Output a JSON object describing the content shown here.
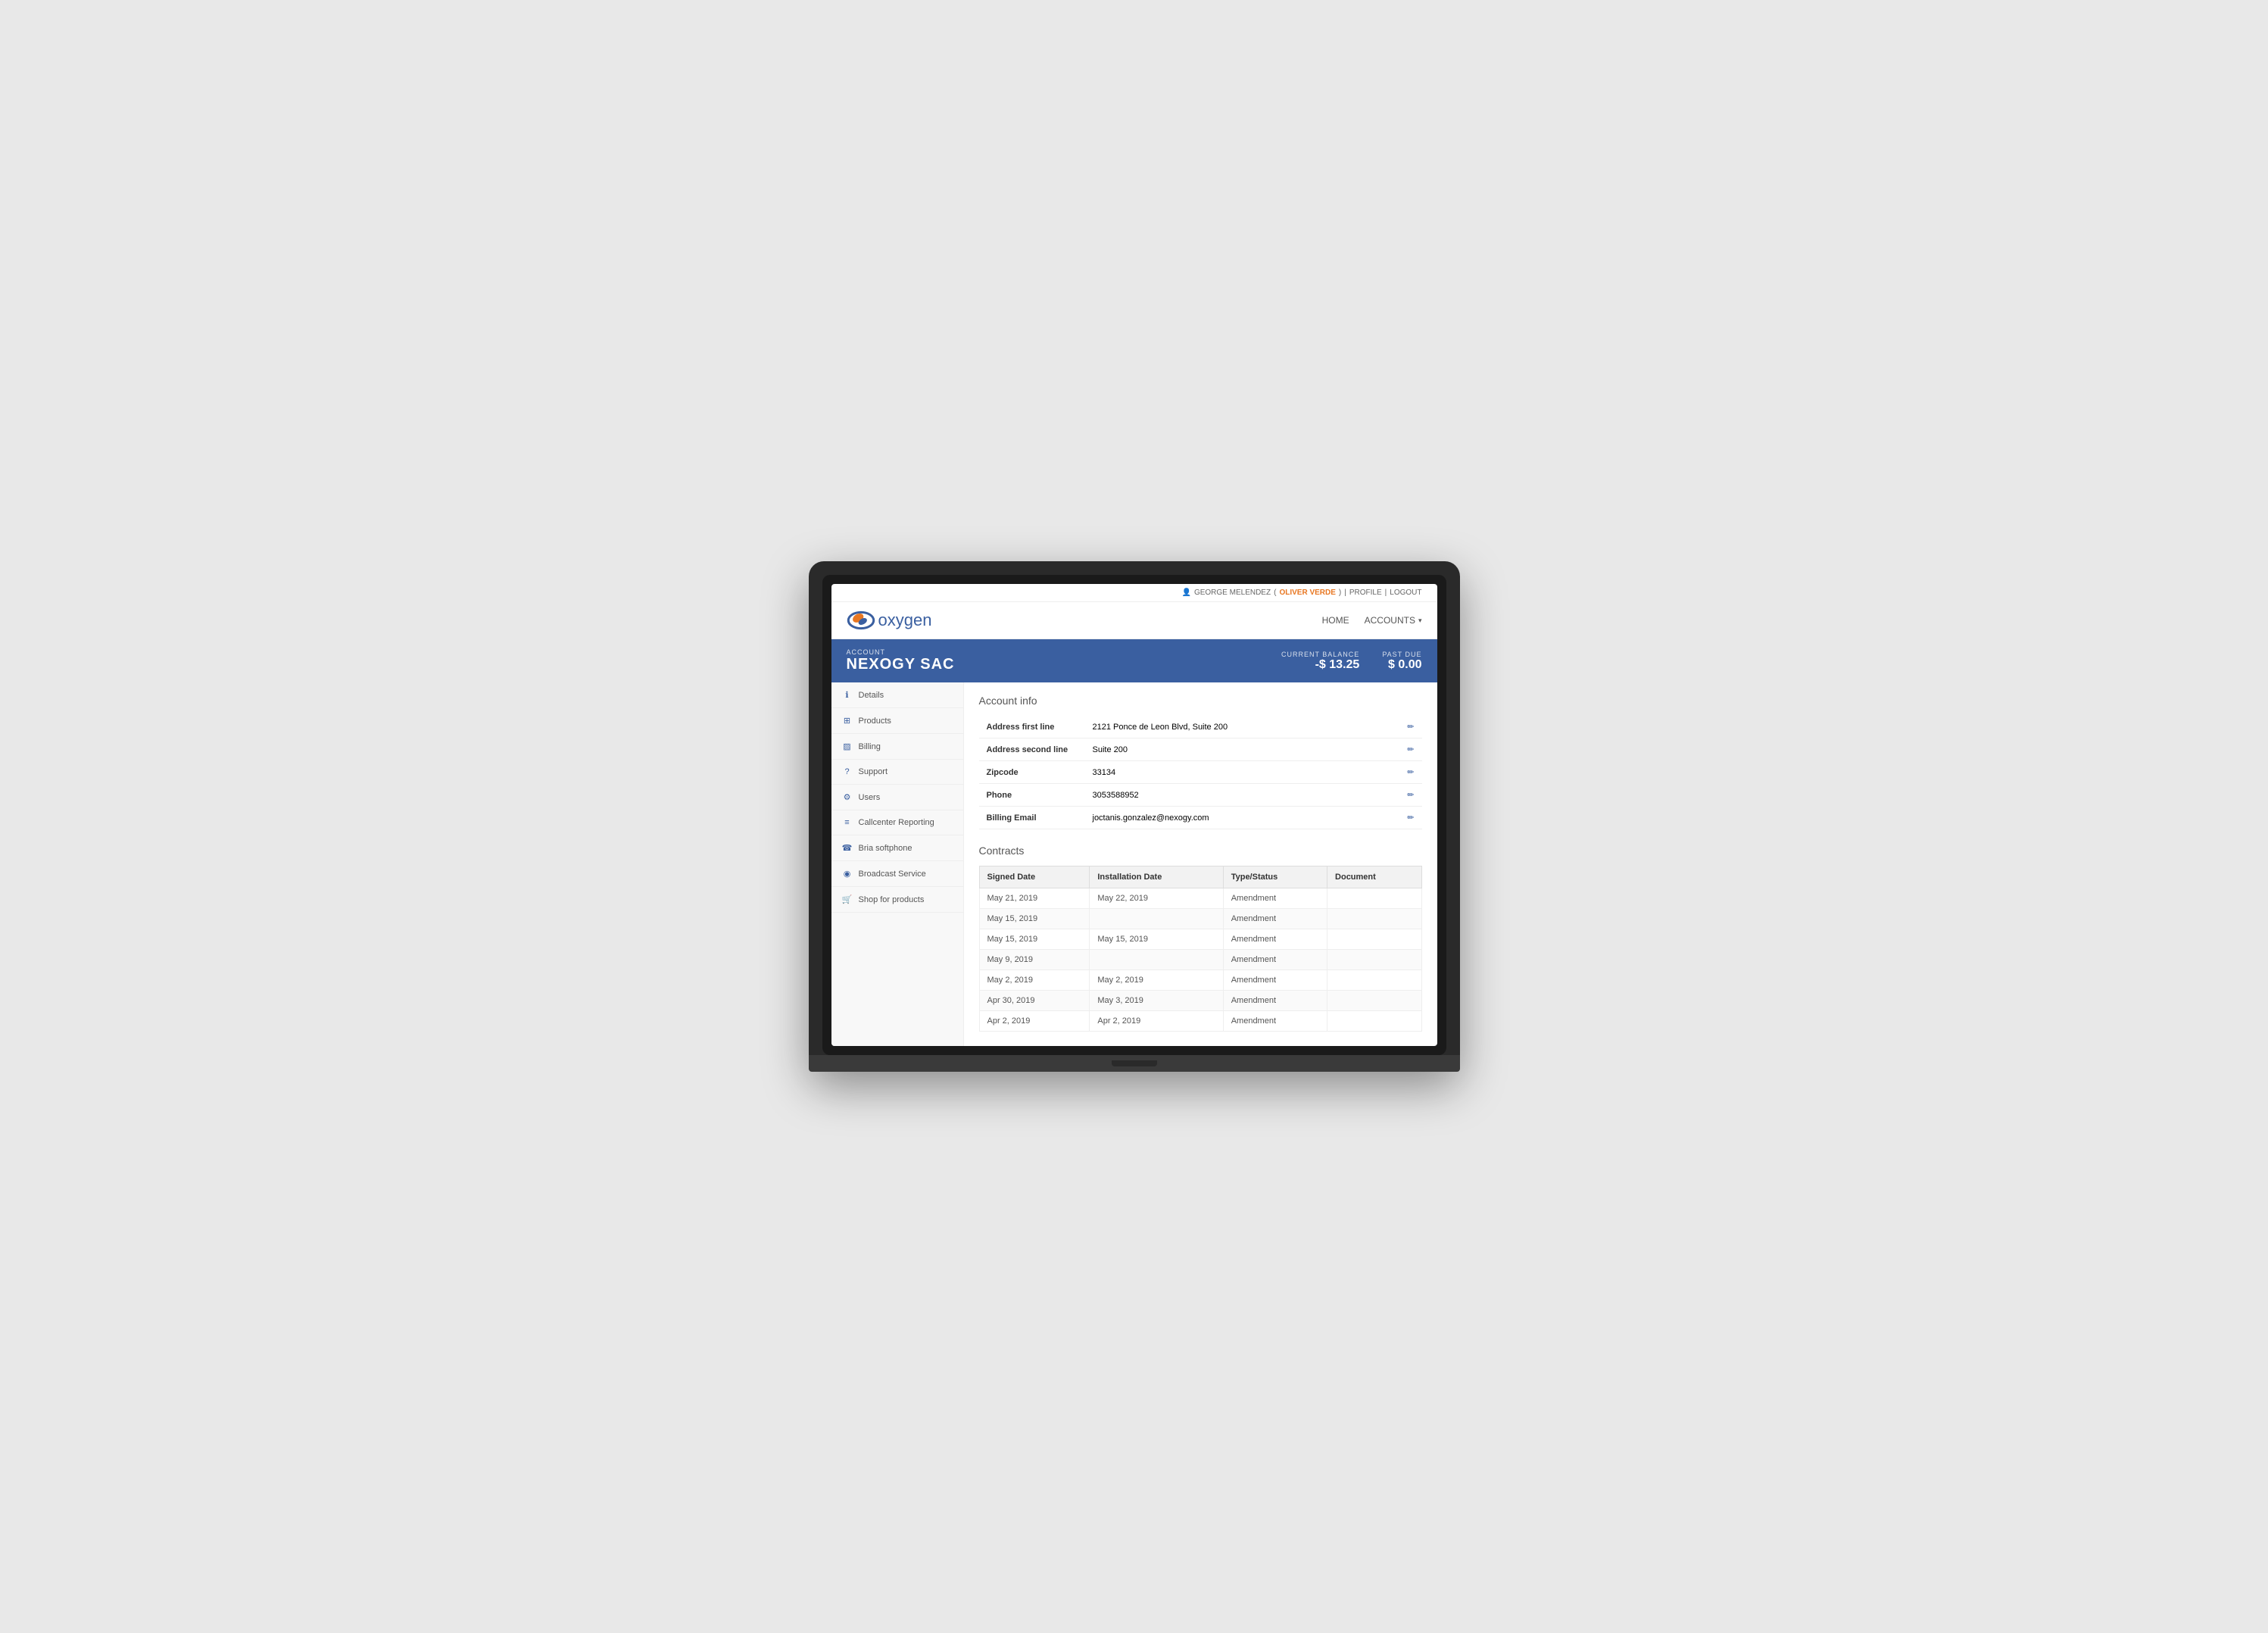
{
  "topbar": {
    "user_label": "GEORGE MELENDEZ",
    "company": "OLIVER VERDE",
    "profile_label": "PROFILE",
    "logout_label": "LOGOUT",
    "separator": "|"
  },
  "navbar": {
    "logo_text_o": "o",
    "logo_text_rest": "xygen",
    "nav_home": "HOME",
    "nav_accounts": "ACCOUNTS"
  },
  "account_header": {
    "account_label": "ACCOUNT",
    "account_name": "NEXOGY SAC",
    "balance_label": "CURRENT BALANCE",
    "balance_value": "-$ 13.25",
    "past_due_label": "PAST DUE",
    "past_due_value": "$ 0.00"
  },
  "sidebar": {
    "items": [
      {
        "label": "Details",
        "icon": "ℹ"
      },
      {
        "label": "Products",
        "icon": "⊞"
      },
      {
        "label": "Billing",
        "icon": "▨"
      },
      {
        "label": "Support",
        "icon": "?"
      },
      {
        "label": "Users",
        "icon": "⚙"
      },
      {
        "label": "Callcenter Reporting",
        "icon": "≡"
      },
      {
        "label": "Bria softphone",
        "icon": "☎"
      },
      {
        "label": "Broadcast Service",
        "icon": "◉"
      },
      {
        "label": "Shop for products",
        "icon": "🛒"
      }
    ]
  },
  "account_info": {
    "section_title": "Account info",
    "fields": [
      {
        "label": "Address first line",
        "value": "2121 Ponce de Leon Blvd, Suite 200"
      },
      {
        "label": "Address second line",
        "value": "Suite 200"
      },
      {
        "label": "Zipcode",
        "value": "33134"
      },
      {
        "label": "Phone",
        "value": "3053588952"
      },
      {
        "label": "Billing Email",
        "value": "joctanis.gonzalez@nexogy.com"
      }
    ]
  },
  "contracts": {
    "section_title": "Contracts",
    "columns": [
      "Signed Date",
      "Installation Date",
      "Type/Status",
      "Document"
    ],
    "rows": [
      {
        "signed": "May 21, 2019",
        "installation": "May 22, 2019",
        "type": "Amendment",
        "document": ""
      },
      {
        "signed": "May 15, 2019",
        "installation": "",
        "type": "Amendment",
        "document": ""
      },
      {
        "signed": "May 15, 2019",
        "installation": "May 15, 2019",
        "type": "Amendment",
        "document": ""
      },
      {
        "signed": "May 9, 2019",
        "installation": "",
        "type": "Amendment",
        "document": ""
      },
      {
        "signed": "May 2, 2019",
        "installation": "May 2, 2019",
        "type": "Amendment",
        "document": ""
      },
      {
        "signed": "Apr 30, 2019",
        "installation": "May 3, 2019",
        "type": "Amendment",
        "document": ""
      },
      {
        "signed": "Apr 2, 2019",
        "installation": "Apr 2, 2019",
        "type": "Amendment",
        "document": ""
      }
    ]
  }
}
